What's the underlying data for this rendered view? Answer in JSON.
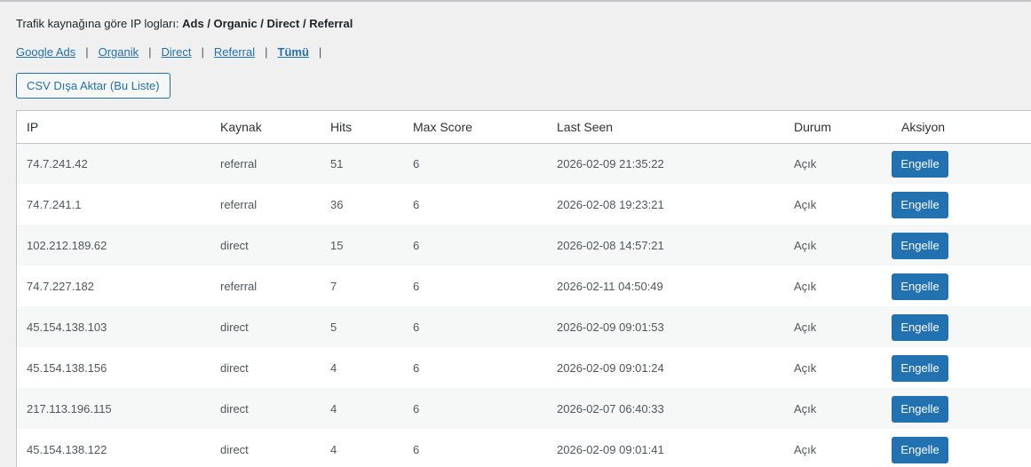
{
  "header": {
    "intro_prefix": "Trafik kaynağına göre IP logları: ",
    "intro_sources": "Ads / Organic / Direct / Referral"
  },
  "filters": {
    "items": [
      {
        "label": "Google Ads",
        "current": false
      },
      {
        "label": "Organik",
        "current": false
      },
      {
        "label": "Direct",
        "current": false
      },
      {
        "label": "Referral",
        "current": false
      },
      {
        "label": "Tümü",
        "current": true
      }
    ],
    "separator": "|"
  },
  "toolbar": {
    "csv_label": "CSV Dışa Aktar (Bu Liste)"
  },
  "table": {
    "columns": [
      "IP",
      "Kaynak",
      "Hits",
      "Max Score",
      "Last Seen",
      "Durum",
      "Aksiyon"
    ],
    "action_label": "Engelle",
    "rows": [
      {
        "ip": "74.7.241.42",
        "source": "referral",
        "hits": "51",
        "max_score": "6",
        "last_seen": "2026-02-09 21:35:22",
        "status": "Açık"
      },
      {
        "ip": "74.7.241.1",
        "source": "referral",
        "hits": "36",
        "max_score": "6",
        "last_seen": "2026-02-08 19:23:21",
        "status": "Açık"
      },
      {
        "ip": "102.212.189.62",
        "source": "direct",
        "hits": "15",
        "max_score": "6",
        "last_seen": "2026-02-08 14:57:21",
        "status": "Açık"
      },
      {
        "ip": "74.7.227.182",
        "source": "referral",
        "hits": "7",
        "max_score": "6",
        "last_seen": "2026-02-11 04:50:49",
        "status": "Açık"
      },
      {
        "ip": "45.154.138.103",
        "source": "direct",
        "hits": "5",
        "max_score": "6",
        "last_seen": "2026-02-09 09:01:53",
        "status": "Açık"
      },
      {
        "ip": "45.154.138.156",
        "source": "direct",
        "hits": "4",
        "max_score": "6",
        "last_seen": "2026-02-09 09:01:24",
        "status": "Açık"
      },
      {
        "ip": "217.113.196.115",
        "source": "direct",
        "hits": "4",
        "max_score": "6",
        "last_seen": "2026-02-07 06:40:33",
        "status": "Açık"
      },
      {
        "ip": "45.154.138.122",
        "source": "direct",
        "hits": "4",
        "max_score": "6",
        "last_seen": "2026-02-09 09:01:41",
        "status": "Açık"
      }
    ]
  },
  "colors": {
    "accent": "#2271b1",
    "background": "#f0f0f1",
    "row_alt": "#f6f7f7"
  }
}
